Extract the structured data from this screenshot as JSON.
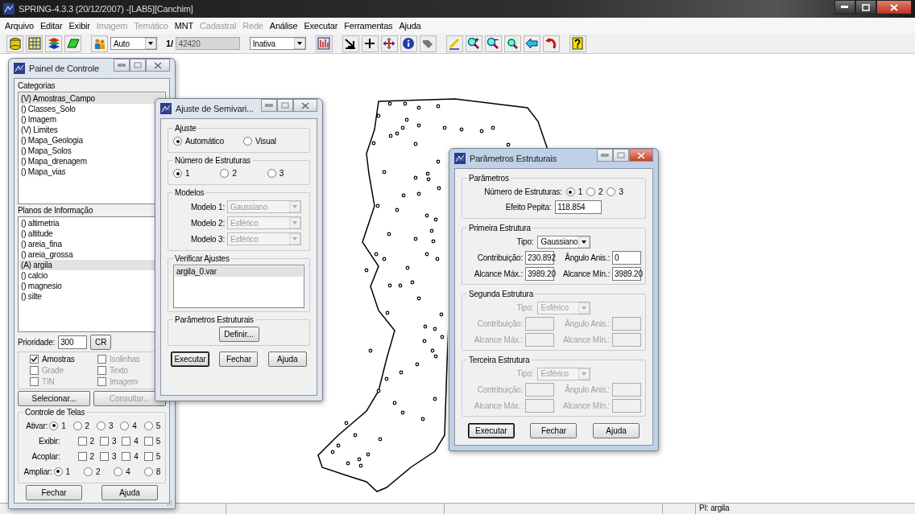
{
  "window": {
    "title": "SPRING-4.3.3 (20/12/2007) -[LAB5][Canchim]"
  },
  "menu": [
    {
      "label": "Arquivo",
      "disabled": false
    },
    {
      "label": "Editar",
      "disabled": false
    },
    {
      "label": "Exibir",
      "disabled": false
    },
    {
      "label": "Imagem",
      "disabled": true
    },
    {
      "label": "Temático",
      "disabled": true
    },
    {
      "label": "MNT",
      "disabled": false
    },
    {
      "label": "Cadastral",
      "disabled": true
    },
    {
      "label": "Rede",
      "disabled": true
    },
    {
      "label": "Análise",
      "disabled": false
    },
    {
      "label": "Executar",
      "disabled": false
    },
    {
      "label": "Ferramentas",
      "disabled": false
    },
    {
      "label": "Ajuda",
      "disabled": false
    }
  ],
  "toolbar": {
    "zoom_mode": "Auto",
    "scale_prefix": "1/",
    "scale": "42420",
    "mode": "Inativa"
  },
  "control_panel": {
    "title": "Painel de Controle",
    "active": false,
    "categories_label": "Categorias",
    "categories": [
      {
        "label": "(V) Amostras_Campo",
        "selected": true
      },
      {
        "label": "() Classes_Solo",
        "selected": false
      },
      {
        "label": "() Imagem",
        "selected": false
      },
      {
        "label": "(V) Limites",
        "selected": false
      },
      {
        "label": "() Mapa_Geologia",
        "selected": false
      },
      {
        "label": "() Mapa_Solos",
        "selected": false
      },
      {
        "label": "() Mapa_drenagem",
        "selected": false
      },
      {
        "label": "() Mapa_vias",
        "selected": false
      }
    ],
    "planes_label": "Planos de Informação",
    "planes": [
      {
        "label": "() altimetria",
        "selected": false
      },
      {
        "label": "() altitude",
        "selected": false
      },
      {
        "label": "() areia_fina",
        "selected": false
      },
      {
        "label": "() areia_grossa",
        "selected": false
      },
      {
        "label": "(A) argila",
        "selected": true
      },
      {
        "label": "() calcio",
        "selected": false
      },
      {
        "label": "() magnesio",
        "selected": false
      },
      {
        "label": "() silte",
        "selected": false
      }
    ],
    "priority_label": "Prioridade:",
    "priority": "300",
    "cr_button": "CR",
    "checks": [
      {
        "label": "Amostras",
        "checked": true,
        "disabled": false
      },
      {
        "label": "Isolinhas",
        "checked": false,
        "disabled": true
      },
      {
        "label": "Grade",
        "checked": false,
        "disabled": true
      },
      {
        "label": "Texto",
        "checked": false,
        "disabled": true
      },
      {
        "label": "TIN",
        "checked": false,
        "disabled": true
      },
      {
        "label": "Imagem",
        "checked": false,
        "disabled": true
      }
    ],
    "select_button": {
      "label": "Selecionar...",
      "disabled": false
    },
    "query_button": {
      "label": "Consultar...",
      "disabled": true
    },
    "screens_title": "Controle de Telas",
    "screens": [
      {
        "label": "Ativar:",
        "kind": "radio",
        "options": [
          {
            "label": "1",
            "selected": true
          },
          {
            "label": "2",
            "selected": false
          },
          {
            "label": "3",
            "selected": false
          },
          {
            "label": "4",
            "selected": false
          },
          {
            "label": "5",
            "selected": false
          }
        ]
      },
      {
        "label": "Exibir:",
        "kind": "check",
        "options": [
          {
            "label": "2",
            "checked": false
          },
          {
            "label": "3",
            "checked": false
          },
          {
            "label": "4",
            "checked": false
          },
          {
            "label": "5",
            "checked": false
          }
        ]
      },
      {
        "label": "Acoplar:",
        "kind": "check",
        "options": [
          {
            "label": "2",
            "checked": false
          },
          {
            "label": "3",
            "checked": false
          },
          {
            "label": "4",
            "checked": false
          },
          {
            "label": "5",
            "checked": false
          }
        ]
      },
      {
        "label": "Ampliar:",
        "kind": "radio",
        "options": [
          {
            "label": "1",
            "selected": true
          },
          {
            "label": "2",
            "selected": false
          },
          {
            "label": "4",
            "selected": false
          },
          {
            "label": "8",
            "selected": false
          }
        ]
      }
    ],
    "buttons": [
      "Fechar",
      "Ajuda"
    ]
  },
  "semivariogram": {
    "title": "Ajuste de Semivari...",
    "active": false,
    "fit_title": "Ajuste",
    "fit_options": [
      {
        "label": "Automático",
        "selected": true
      },
      {
        "label": "Visual",
        "selected": false
      }
    ],
    "count_title": "Número de Estruturas",
    "count_options": [
      {
        "label": "1",
        "selected": true
      },
      {
        "label": "2",
        "selected": false
      },
      {
        "label": "3",
        "selected": false
      }
    ],
    "models_title": "Modelos",
    "models": [
      {
        "label": "Modelo 1:",
        "value": "Gaussiano",
        "disabled": true
      },
      {
        "label": "Modelo 2:",
        "value": "Esférico",
        "disabled": true
      },
      {
        "label": "Modelo 3:",
        "value": "Esférico",
        "disabled": true
      }
    ],
    "check_title": "Verificar Ajustes",
    "files": [
      {
        "label": "argila_0.var",
        "selected": true
      }
    ],
    "params_title": "Parâmetros Estruturais",
    "define_button": "Definir...",
    "buttons": [
      "Executar",
      "Fechar",
      "Ajuda"
    ]
  },
  "parameters": {
    "title": "Parâmetros Estruturais",
    "active": true,
    "group_title": "Parâmetros",
    "count_label": "Número de Estruturas:",
    "count_options": [
      {
        "label": "1",
        "selected": true
      },
      {
        "label": "2",
        "selected": false
      },
      {
        "label": "3",
        "selected": false
      }
    ],
    "nugget_label": "Efeito Pepita:",
    "nugget": "118.854",
    "structures": [
      {
        "title": "Primeira Estrutura",
        "disabled": false,
        "type_label": "Tipo:",
        "type": "Gaussiano",
        "contribution_label": "Contribuição:",
        "contribution": "230.892",
        "angle_label": "Ângulo Anis.:",
        "angle": "0",
        "max_label": "Alcance Máx.:",
        "max": "3989.20",
        "min_label": "Alcance Mín.:",
        "min": "3989.20"
      },
      {
        "title": "Segunda Estrutura",
        "disabled": true,
        "type_label": "Tipo:",
        "type": "Esférico",
        "contribution_label": "Contribuição:",
        "angle_label": "Ângulo Anis.:",
        "max_label": "Alcance Máx.:",
        "min_label": "Alcance Mín.:"
      },
      {
        "title": "Terceira Estrutura",
        "disabled": true,
        "type_label": "Tipo:",
        "type": "Esférico",
        "contribution_label": "Contribuição:",
        "angle_label": "Ângulo Anis.:",
        "max_label": "Alcance Máx.:",
        "min_label": "Alcance Mín.:"
      }
    ],
    "buttons": [
      "Executar",
      "Fechar",
      "Ajuda"
    ]
  },
  "status_bar": {
    "plane": "PI: argila"
  }
}
